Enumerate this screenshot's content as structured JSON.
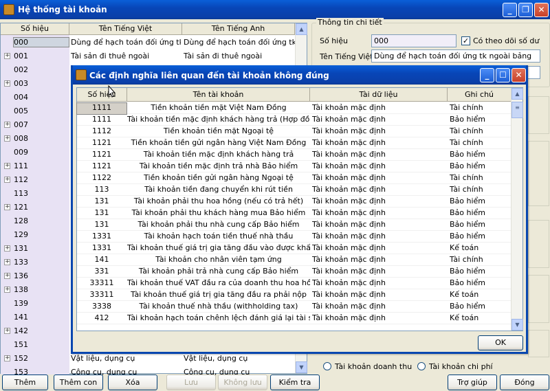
{
  "window": {
    "title": "Hệ thống tài khoản"
  },
  "left": {
    "headers": [
      "Số hiệu",
      "Tên Tiếng Việt",
      "Tên Tiếng Anh"
    ],
    "rows": [
      {
        "code": "000",
        "vn": "Dùng để hạch toán đối ứng tk ngoài bảng",
        "en": "Dùng để hạch toán đối ứng tk ngoài bảng",
        "expand": false
      },
      {
        "code": "001",
        "vn": "Tài sản đi thuê ngoài",
        "en": "Tài sản đi thuê ngoài",
        "expand": true
      },
      {
        "code": "002",
        "vn": "",
        "en": "",
        "expand": false
      },
      {
        "code": "003",
        "vn": "",
        "en": "",
        "expand": true
      },
      {
        "code": "004",
        "vn": "",
        "en": "",
        "expand": false
      },
      {
        "code": "005",
        "vn": "",
        "en": "",
        "expand": false
      },
      {
        "code": "007",
        "vn": "",
        "en": "",
        "expand": true
      },
      {
        "code": "008",
        "vn": "",
        "en": "",
        "expand": true
      },
      {
        "code": "009",
        "vn": "",
        "en": "",
        "expand": false
      },
      {
        "code": "111",
        "vn": "",
        "en": "",
        "expand": true
      },
      {
        "code": "112",
        "vn": "",
        "en": "",
        "expand": true
      },
      {
        "code": "113",
        "vn": "",
        "en": "",
        "expand": false
      },
      {
        "code": "121",
        "vn": "",
        "en": "",
        "expand": true
      },
      {
        "code": "128",
        "vn": "",
        "en": "",
        "expand": false
      },
      {
        "code": "129",
        "vn": "",
        "en": "",
        "expand": false
      },
      {
        "code": "131",
        "vn": "",
        "en": "",
        "expand": true
      },
      {
        "code": "133",
        "vn": "",
        "en": "",
        "expand": true
      },
      {
        "code": "136",
        "vn": "",
        "en": "",
        "expand": true
      },
      {
        "code": "138",
        "vn": "",
        "en": "",
        "expand": true
      },
      {
        "code": "139",
        "vn": "",
        "en": "",
        "expand": false
      },
      {
        "code": "141",
        "vn": "",
        "en": "",
        "expand": false
      },
      {
        "code": "142",
        "vn": "",
        "en": "",
        "expand": true
      },
      {
        "code": "151",
        "vn": "",
        "en": "",
        "expand": false
      },
      {
        "code": "152",
        "vn": "Vật liệu, dụng cụ",
        "en": "Vật liệu, dụng cụ",
        "expand": true
      },
      {
        "code": "153",
        "vn": "Công cụ, dụng cụ",
        "en": "Công cụ, dụng cụ",
        "expand": false
      }
    ]
  },
  "detail": {
    "group_title": "Thông tin chi tiết",
    "so_hieu_label": "Số hiệu",
    "so_hieu_value": "000",
    "theo_doi_label": "Có theo dõi số dư",
    "ten_vn_label": "Tên Tiếng Việt",
    "ten_vn_value": "Dùng để hạch toán đối ứng tk ngoài bảng",
    "radio_doanh_thu": "Tài khoản doanh thu",
    "radio_chi_phi": "Tài khoản chi phí"
  },
  "buttons": {
    "them": "Thêm",
    "them_con": "Thêm con",
    "xoa": "Xóa",
    "luu": "Lưu",
    "khong_luu": "Không lưu",
    "kiem_tra": "Kiểm tra",
    "tro_giup": "Trợ giúp",
    "dong": "Đóng"
  },
  "dialog": {
    "title": "Các định nghĩa liên quan đến tài khoản không đúng",
    "headers": [
      "Số hiệu",
      "Tên tài khoản",
      "Tài dữ liệu",
      "Ghi chú"
    ],
    "ok": "OK",
    "rows": [
      {
        "code": "1111",
        "name": "Tiền khoản tiền mặt Việt Nam Đồng",
        "data": "Tài khoản mặc định",
        "note": "Tài chính"
      },
      {
        "code": "1111",
        "name": "Tài khoản tiền mặc định khách hàng trả (Hợp đồng trực",
        "data": "Tài khoản mặc định",
        "note": "Bảo hiểm"
      },
      {
        "code": "1112",
        "name": "Tiền khoản tiền mặt Ngoại tệ",
        "data": "Tài khoản mặc định",
        "note": "Tài chính"
      },
      {
        "code": "1121",
        "name": "Tiền khoản tiền gửi ngân hàng Việt Nam Đồng",
        "data": "Tài khoản mặc định",
        "note": "Tài chính"
      },
      {
        "code": "1121",
        "name": "Tài khoản tiền mặc định khách hàng trả",
        "data": "Tài khoản mặc định",
        "note": "Bảo hiểm"
      },
      {
        "code": "1121",
        "name": "Tài khoản tiền mặc định trả nhà Bảo hiểm",
        "data": "Tài khoản mặc định",
        "note": "Bảo hiểm"
      },
      {
        "code": "1122",
        "name": "Tiền khoản tiền gửi ngân hàng Ngoại tệ",
        "data": "Tài khoản mặc định",
        "note": "Tài chính"
      },
      {
        "code": "113",
        "name": "Tài khoản tiền đang chuyển khi rút tiền",
        "data": "Tài khoản mặc định",
        "note": "Tài chính"
      },
      {
        "code": "131",
        "name": "Tài khoản phải thu hoa hồng (nếu có trả hết)",
        "data": "Tài khoản mặc định",
        "note": "Bảo hiểm"
      },
      {
        "code": "131",
        "name": "Tài khoản phải thu khách hàng mua Bảo hiểm",
        "data": "Tài khoản mặc định",
        "note": "Bảo hiểm"
      },
      {
        "code": "131",
        "name": "Tài khoản phải thu nhà cung cấp Bảo hiểm",
        "data": "Tài khoản mặc định",
        "note": "Bảo hiểm"
      },
      {
        "code": "1331",
        "name": "Tài khoản hạch toán tiền thuế nhà thầu",
        "data": "Tài khoản mặc định",
        "note": "Bảo hiểm"
      },
      {
        "code": "1331",
        "name": "Tài khoản thuế giá trị gia tăng đầu vào được khấu trừ",
        "data": "Tài khoản mặc định",
        "note": "Kế toán"
      },
      {
        "code": "141",
        "name": "Tài khoản cho nhân viên tạm ứng",
        "data": "Tài khoản mặc định",
        "note": "Tài chính"
      },
      {
        "code": "331",
        "name": "Tài khoản phải trả nhà cung cấp Bảo hiểm",
        "data": "Tài khoản mặc định",
        "note": "Bảo hiểm"
      },
      {
        "code": "33311",
        "name": "Tài khoản thuế VAT đầu ra của doanh thu hoa hồng",
        "data": "Tài khoản mặc định",
        "note": "Bảo hiểm"
      },
      {
        "code": "33311",
        "name": "Tài khoản thuế giá trị gia tăng đầu ra phải nộp",
        "data": "Tài khoản mặc định",
        "note": "Kế toán"
      },
      {
        "code": "3338",
        "name": "Tài khoản thuế nhà thầu (withholding tax)",
        "data": "Tài khoản mặc định",
        "note": "Bảo hiểm"
      },
      {
        "code": "412",
        "name": "Tài khoản hạch toán chênh lệch đánh giá lại tài sản",
        "data": "Tài khoản mặc định",
        "note": "Kế toán"
      }
    ]
  }
}
